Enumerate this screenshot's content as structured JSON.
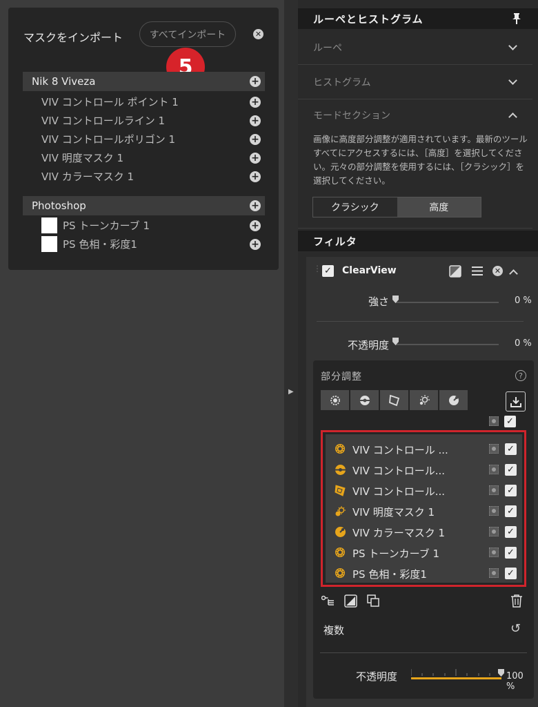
{
  "import_panel": {
    "title": "マスクをインポート",
    "import_all_label": "すべてインポート",
    "step_badge": "5",
    "groups": [
      {
        "name": "Nik 8 Viveza",
        "items": [
          "VIV コントロール ポイント 1",
          "VIV コントロールライン 1",
          "VIV コントロールポリゴン 1",
          "VIV 明度マスク 1",
          "VIV カラーマスク 1"
        ]
      },
      {
        "name": "Photoshop",
        "items": [
          "PS トーンカーブ 1",
          "PS 色相・彩度1"
        ]
      }
    ]
  },
  "loupe_section": {
    "header": "ルーペとヒストグラム",
    "rows": [
      "ルーペ",
      "ヒストグラム",
      "モードセクション"
    ],
    "mode_description": "画像に高度部分調整が適用されています。最新のツールすべてにアクセスするには、［高度］を選択してください。元々の部分調整を使用するには、［クラシック］を選択してください。",
    "segment": {
      "options": [
        "クラシック",
        "高度"
      ],
      "selected": "高度"
    }
  },
  "filter_section": {
    "header": "フィルタ",
    "filter": {
      "name": "ClearView",
      "strength": {
        "label": "強さ",
        "value": "0 %"
      },
      "opacity": {
        "label": "不透明度",
        "value": "0 %"
      }
    },
    "local_adjust": {
      "title": "部分調整",
      "help": "?",
      "tools": [
        "control-point-tool",
        "control-line-tool",
        "polygon-tool",
        "luminance-mask-tool",
        "color-mask-tool"
      ],
      "masks": [
        {
          "label": "VIV コントロール ...",
          "icon": "control-point"
        },
        {
          "label": "VIV コントロール...",
          "icon": "control-line"
        },
        {
          "label": "VIV コントロール...",
          "icon": "polygon"
        },
        {
          "label": "VIV 明度マスク 1",
          "icon": "luminance"
        },
        {
          "label": "VIV カラーマスク 1",
          "icon": "color"
        },
        {
          "label": "PS トーンカーブ 1",
          "icon": "control-point"
        },
        {
          "label": "PS 色相・彩度1",
          "icon": "control-point"
        }
      ],
      "duplicate_label": "複数",
      "opacity": {
        "label": "不透明度",
        "value": "100 %",
        "fraction": 1.0
      }
    }
  },
  "colors": {
    "accent": "#e7a51b",
    "highlight": "#d0242c",
    "badge": "#d7232a"
  }
}
